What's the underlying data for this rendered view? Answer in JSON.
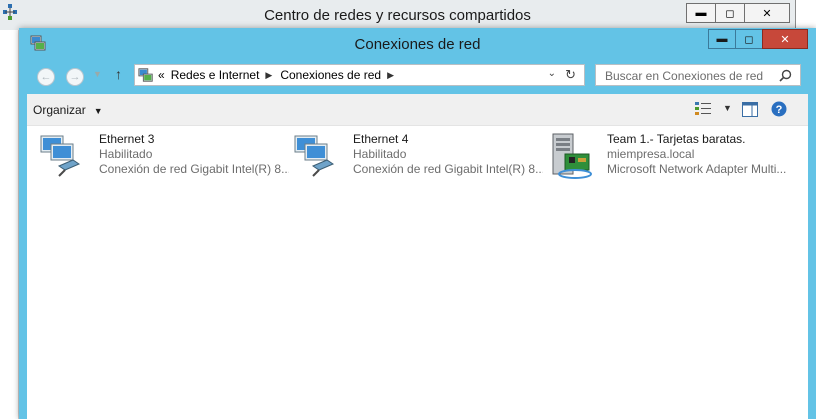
{
  "back_window": {
    "title": "Centro de redes y recursos compartidos",
    "controls": {
      "minimize": "▬",
      "maximize": "◻",
      "close": "✕"
    }
  },
  "front_window": {
    "title": "Conexiones de red",
    "controls": {
      "minimize": "▬",
      "maximize": "◻",
      "close": "✕"
    }
  },
  "navigation": {
    "back_icon": "back-arrow-icon",
    "forward_icon": "forward-arrow-icon",
    "recent_dropdown_icon": "chevron-down-icon",
    "up_icon": "up-arrow-icon",
    "breadcrumb_overflow": "«",
    "breadcrumb": [
      "Redes e Internet",
      "Conexiones de red"
    ],
    "search_placeholder": "Buscar en Conexiones de red"
  },
  "toolbar": {
    "organize_label": "Organizar",
    "view_icon": "view-options-icon",
    "preview_pane_icon": "preview-pane-icon",
    "help_icon": "help-icon"
  },
  "connections": [
    {
      "name": "Ethernet 3",
      "status": "Habilitado",
      "adapter": "Conexión de red Gigabit Intel(R) 8...",
      "icon": "network-adapter-icon"
    },
    {
      "name": "Ethernet 4",
      "status": "Habilitado",
      "adapter": "Conexión de red Gigabit Intel(R) 8...",
      "icon": "network-adapter-icon"
    },
    {
      "name": "Team 1.- Tarjetas baratas.",
      "status": "miempresa.local",
      "adapter": "Microsoft Network Adapter Multi...",
      "icon": "network-team-icon"
    }
  ],
  "colors": {
    "front_frame": "#63c3e6",
    "back_frame": "#e8ecee",
    "close_button": "#c7483a",
    "toolbar_bg": "#f0f0f0",
    "secondary_text": "#6d6d6d"
  }
}
